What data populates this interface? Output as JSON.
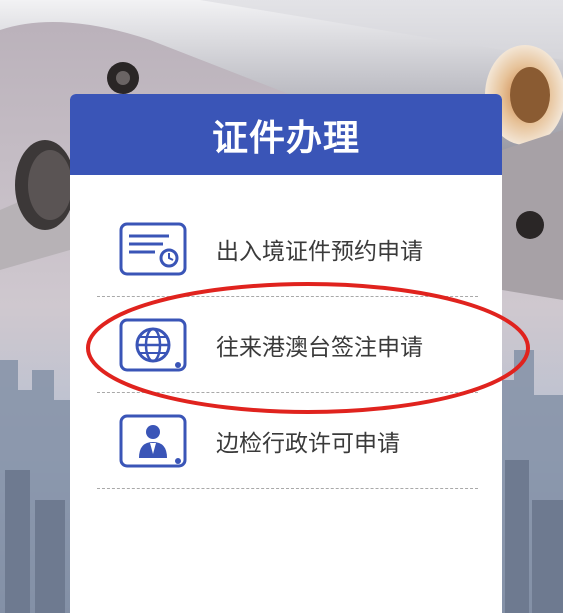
{
  "card": {
    "title": "证件办理",
    "items": [
      {
        "label": "出入境证件预约申请",
        "icon": "calendar-card-icon"
      },
      {
        "label": "往来港澳台签注申请",
        "icon": "globe-icon"
      },
      {
        "label": "边检行政许可申请",
        "icon": "officer-badge-icon"
      }
    ]
  },
  "colors": {
    "header": "#3a55b7",
    "icon": "#3a55b7",
    "annotation": "#e0231e",
    "divider": "#a9a9a9"
  }
}
